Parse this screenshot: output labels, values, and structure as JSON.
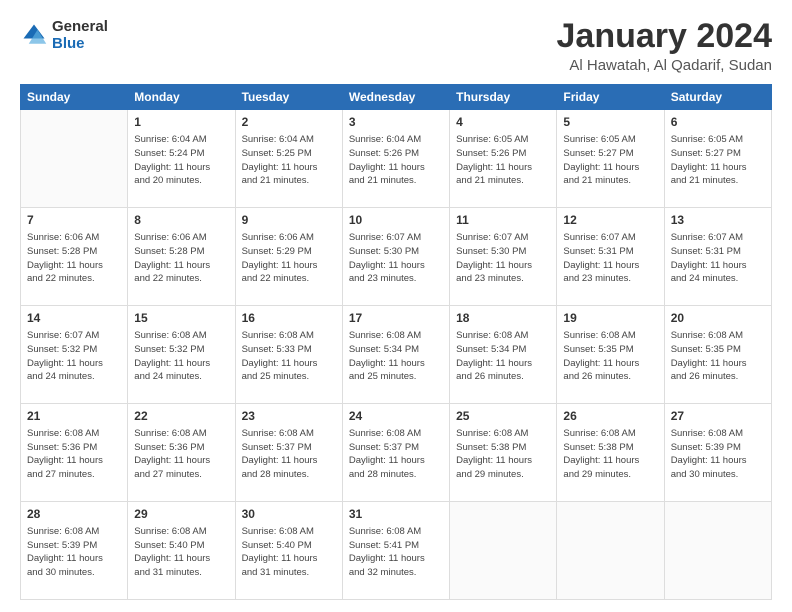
{
  "header": {
    "logo_general": "General",
    "logo_blue": "Blue",
    "title": "January 2024",
    "subtitle": "Al Hawatah, Al Qadarif, Sudan"
  },
  "calendar": {
    "days_of_week": [
      "Sunday",
      "Monday",
      "Tuesday",
      "Wednesday",
      "Thursday",
      "Friday",
      "Saturday"
    ],
    "weeks": [
      [
        {
          "day": "",
          "info": ""
        },
        {
          "day": "1",
          "info": "Sunrise: 6:04 AM\nSunset: 5:24 PM\nDaylight: 11 hours\nand 20 minutes."
        },
        {
          "day": "2",
          "info": "Sunrise: 6:04 AM\nSunset: 5:25 PM\nDaylight: 11 hours\nand 21 minutes."
        },
        {
          "day": "3",
          "info": "Sunrise: 6:04 AM\nSunset: 5:26 PM\nDaylight: 11 hours\nand 21 minutes."
        },
        {
          "day": "4",
          "info": "Sunrise: 6:05 AM\nSunset: 5:26 PM\nDaylight: 11 hours\nand 21 minutes."
        },
        {
          "day": "5",
          "info": "Sunrise: 6:05 AM\nSunset: 5:27 PM\nDaylight: 11 hours\nand 21 minutes."
        },
        {
          "day": "6",
          "info": "Sunrise: 6:05 AM\nSunset: 5:27 PM\nDaylight: 11 hours\nand 21 minutes."
        }
      ],
      [
        {
          "day": "7",
          "info": "Sunrise: 6:06 AM\nSunset: 5:28 PM\nDaylight: 11 hours\nand 22 minutes."
        },
        {
          "day": "8",
          "info": "Sunrise: 6:06 AM\nSunset: 5:28 PM\nDaylight: 11 hours\nand 22 minutes."
        },
        {
          "day": "9",
          "info": "Sunrise: 6:06 AM\nSunset: 5:29 PM\nDaylight: 11 hours\nand 22 minutes."
        },
        {
          "day": "10",
          "info": "Sunrise: 6:07 AM\nSunset: 5:30 PM\nDaylight: 11 hours\nand 23 minutes."
        },
        {
          "day": "11",
          "info": "Sunrise: 6:07 AM\nSunset: 5:30 PM\nDaylight: 11 hours\nand 23 minutes."
        },
        {
          "day": "12",
          "info": "Sunrise: 6:07 AM\nSunset: 5:31 PM\nDaylight: 11 hours\nand 23 minutes."
        },
        {
          "day": "13",
          "info": "Sunrise: 6:07 AM\nSunset: 5:31 PM\nDaylight: 11 hours\nand 24 minutes."
        }
      ],
      [
        {
          "day": "14",
          "info": "Sunrise: 6:07 AM\nSunset: 5:32 PM\nDaylight: 11 hours\nand 24 minutes."
        },
        {
          "day": "15",
          "info": "Sunrise: 6:08 AM\nSunset: 5:32 PM\nDaylight: 11 hours\nand 24 minutes."
        },
        {
          "day": "16",
          "info": "Sunrise: 6:08 AM\nSunset: 5:33 PM\nDaylight: 11 hours\nand 25 minutes."
        },
        {
          "day": "17",
          "info": "Sunrise: 6:08 AM\nSunset: 5:34 PM\nDaylight: 11 hours\nand 25 minutes."
        },
        {
          "day": "18",
          "info": "Sunrise: 6:08 AM\nSunset: 5:34 PM\nDaylight: 11 hours\nand 26 minutes."
        },
        {
          "day": "19",
          "info": "Sunrise: 6:08 AM\nSunset: 5:35 PM\nDaylight: 11 hours\nand 26 minutes."
        },
        {
          "day": "20",
          "info": "Sunrise: 6:08 AM\nSunset: 5:35 PM\nDaylight: 11 hours\nand 26 minutes."
        }
      ],
      [
        {
          "day": "21",
          "info": "Sunrise: 6:08 AM\nSunset: 5:36 PM\nDaylight: 11 hours\nand 27 minutes."
        },
        {
          "day": "22",
          "info": "Sunrise: 6:08 AM\nSunset: 5:36 PM\nDaylight: 11 hours\nand 27 minutes."
        },
        {
          "day": "23",
          "info": "Sunrise: 6:08 AM\nSunset: 5:37 PM\nDaylight: 11 hours\nand 28 minutes."
        },
        {
          "day": "24",
          "info": "Sunrise: 6:08 AM\nSunset: 5:37 PM\nDaylight: 11 hours\nand 28 minutes."
        },
        {
          "day": "25",
          "info": "Sunrise: 6:08 AM\nSunset: 5:38 PM\nDaylight: 11 hours\nand 29 minutes."
        },
        {
          "day": "26",
          "info": "Sunrise: 6:08 AM\nSunset: 5:38 PM\nDaylight: 11 hours\nand 29 minutes."
        },
        {
          "day": "27",
          "info": "Sunrise: 6:08 AM\nSunset: 5:39 PM\nDaylight: 11 hours\nand 30 minutes."
        }
      ],
      [
        {
          "day": "28",
          "info": "Sunrise: 6:08 AM\nSunset: 5:39 PM\nDaylight: 11 hours\nand 30 minutes."
        },
        {
          "day": "29",
          "info": "Sunrise: 6:08 AM\nSunset: 5:40 PM\nDaylight: 11 hours\nand 31 minutes."
        },
        {
          "day": "30",
          "info": "Sunrise: 6:08 AM\nSunset: 5:40 PM\nDaylight: 11 hours\nand 31 minutes."
        },
        {
          "day": "31",
          "info": "Sunrise: 6:08 AM\nSunset: 5:41 PM\nDaylight: 11 hours\nand 32 minutes."
        },
        {
          "day": "",
          "info": ""
        },
        {
          "day": "",
          "info": ""
        },
        {
          "day": "",
          "info": ""
        }
      ]
    ]
  }
}
